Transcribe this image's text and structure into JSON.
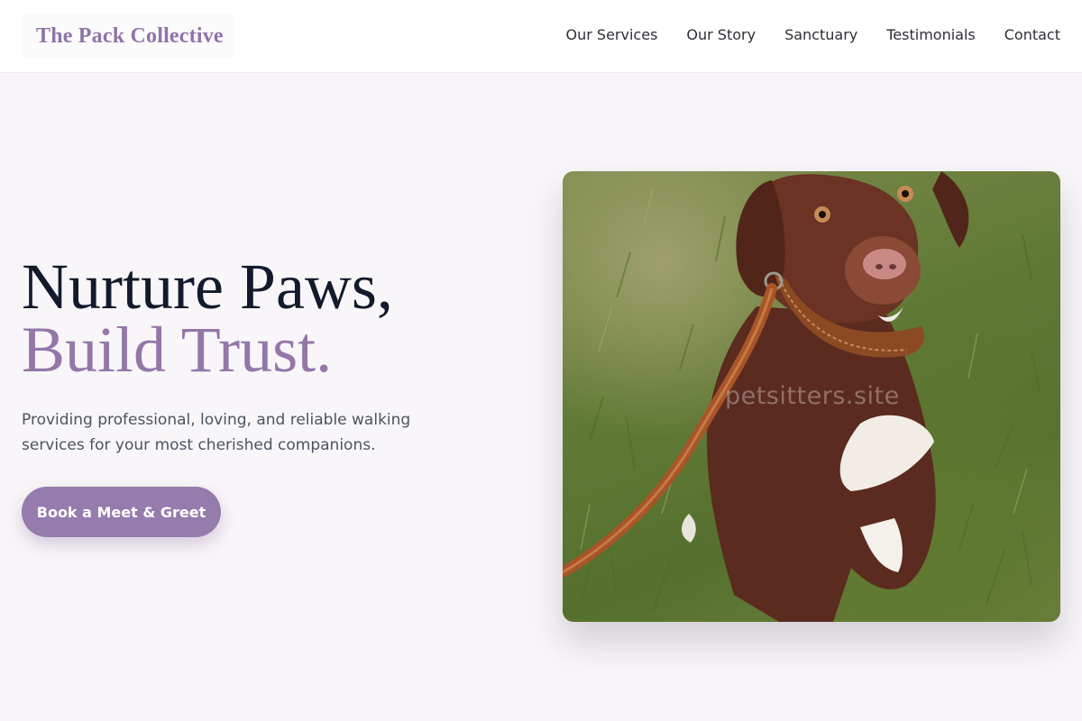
{
  "header": {
    "logo": "The Pack Collective",
    "nav": [
      "Our Services",
      "Our Story",
      "Sanctuary",
      "Testimonials",
      "Contact"
    ]
  },
  "hero": {
    "title_line1": "Nurture Paws,",
    "title_line2": "Build Trust.",
    "subtitle": "Providing professional, loving, and reliable walking services for your most cherished companions.",
    "cta_label": "Book a Meet & Greet",
    "image_watermark": "petsitters.site"
  },
  "colors": {
    "accent": "#967bad",
    "logo": "#8f74a8",
    "heading": "#121a2c",
    "background": "#f8f6f8"
  }
}
